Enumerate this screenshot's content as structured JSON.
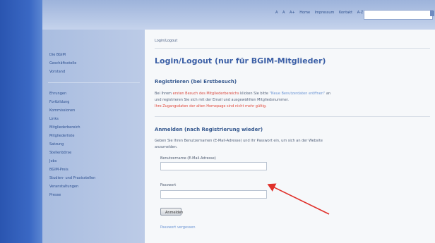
{
  "topbar": {
    "links": [
      "A",
      "A",
      "A+",
      "Home",
      "Impressum",
      "Kontakt",
      "A-Z"
    ],
    "search_placeholder": ""
  },
  "sidebar": {
    "items": [
      {
        "label": "Die BGIM"
      },
      {
        "label": "Geschäftsstelle"
      },
      {
        "label": "Vorstand"
      },
      {
        "label": "Ehrungen"
      },
      {
        "label": "Fortbildung"
      },
      {
        "label": "Kommissionen"
      },
      {
        "label": "Links"
      },
      {
        "label": "Mitgliederbereich"
      },
      {
        "label": "Mitgliederliste"
      },
      {
        "label": "Satzung"
      },
      {
        "label": "Stellenbörse"
      },
      {
        "label": "Jobs"
      },
      {
        "label": "BGIM-Preis"
      },
      {
        "label": "Studien- und Praxisstellen"
      },
      {
        "label": "Veranstaltungen"
      },
      {
        "label": "Presse"
      }
    ]
  },
  "content": {
    "breadcrumb": "Login/Logout",
    "title": "Login/Logout (nur für BGIM-Mitglieder)",
    "register_heading": "Registrieren (bei Erstbesuch)",
    "register_line1_a": "Bei Ihrem",
    "register_line1_red": "ersten Besuch des Mitgliederbereichs",
    "register_line1_b": "klicken Sie bitte",
    "register_line1_link": "\"Neue Benutzerdaten eröffnen\"",
    "register_line1_c": "an",
    "register_line2": "und registrieren Sie sich mit der Email und ausgewählten Mitgliedsnummer.",
    "register_red": "Ihre Zugangsdaten der alten Homepage sind nicht mehr gültig.",
    "login_heading": "Anmelden (nach Registrierung wieder)",
    "login_line1": "Geben Sie Ihren Benutzernamen (E-Mail-Adresse) und Ihr Passwort ein, um sich an der Website",
    "login_line2": "anzumelden.",
    "username_label": "Benutzername (E-Mail-Adresse)",
    "username_value": "",
    "password_label": "Passwort",
    "password_value": "",
    "login_button": "Anmelden",
    "forgot_link": "Passwort vergessen"
  },
  "colors": {
    "sidebar_blue": "#2a55b0",
    "title_blue": "#3b5fa6",
    "warning_red": "#e2483a",
    "arrow_red": "#e0302a"
  }
}
